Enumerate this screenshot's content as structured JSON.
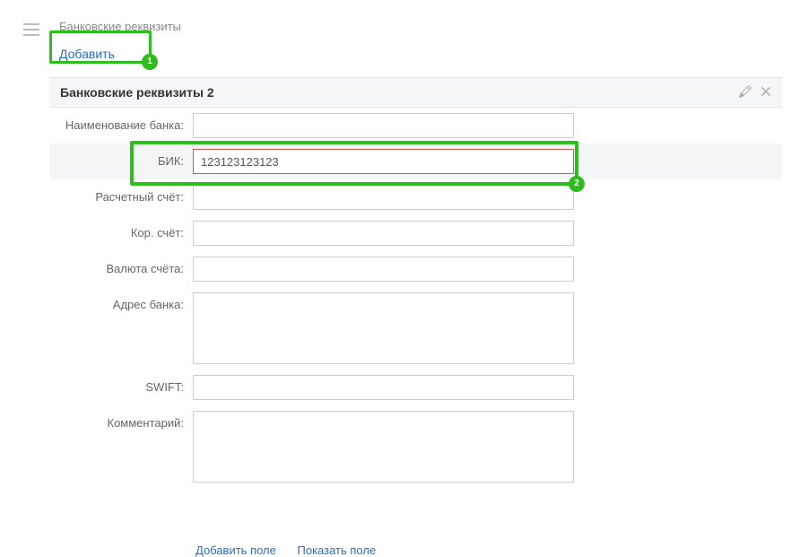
{
  "page_title": "Банковские реквизиты",
  "add_link": "Добавить",
  "section": {
    "title": "Банковские реквизиты 2"
  },
  "annotations": {
    "badge1": "1",
    "badge2": "2"
  },
  "fields": {
    "bank_name": {
      "label": "Наименование банка:",
      "value": ""
    },
    "bik": {
      "label": "БИК:",
      "value": "123123123123"
    },
    "account": {
      "label": "Расчетный счёт:",
      "value": ""
    },
    "corr_account": {
      "label": "Кор. счёт:",
      "value": ""
    },
    "currency": {
      "label": "Валюта счёта:",
      "value": ""
    },
    "bank_address": {
      "label": "Адрес банка:",
      "value": ""
    },
    "swift": {
      "label": "SWIFT:",
      "value": ""
    },
    "comment": {
      "label": "Комментарий:",
      "value": ""
    }
  },
  "bottom": {
    "add_field": "Добавить поле",
    "show_field": "Показать поле"
  }
}
